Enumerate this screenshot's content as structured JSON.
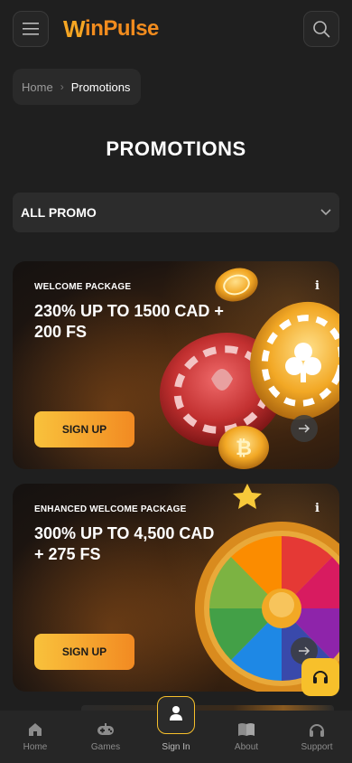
{
  "header": {
    "logo_w": "W",
    "logo_rest": "inPulse",
    "menu_icon": "hamburger-menu-icon",
    "search_icon": "search-icon"
  },
  "breadcrumb": {
    "home": "Home",
    "current": "Promotions"
  },
  "page_title": "PROMOTIONS",
  "filter": {
    "selected": "ALL PROMO",
    "icon": "chevron-down-icon"
  },
  "promos": [
    {
      "label": "WELCOME PACKAGE",
      "title": "230% UP TO 1500 CAD + 200 FS",
      "button": "SIGN UP",
      "info": "i"
    },
    {
      "label": "ENHANCED WELCOME PACKAGE",
      "title": "300% UP TO 4,500 CAD + 275 FS",
      "button": "SIGN UP",
      "info": "i"
    }
  ],
  "nav": {
    "home": "Home",
    "games": "Games",
    "signin": "Sign In",
    "about": "About",
    "support": "Support"
  },
  "colors": {
    "accent": "#f7c02b",
    "brand_orange": "#f28c1e",
    "background": "#1f1f1f"
  }
}
